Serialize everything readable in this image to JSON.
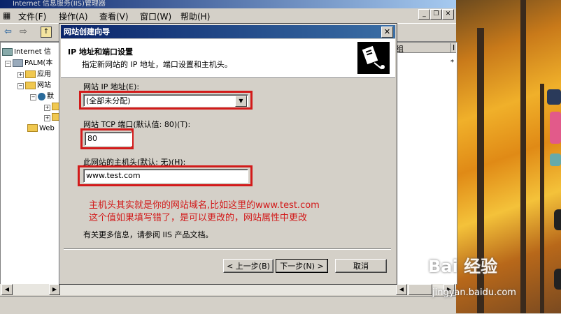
{
  "mmc": {
    "title": "Internet 信息服务(IIS)管理器",
    "menu": [
      "文件(F)",
      "操作(A)",
      "查看(V)",
      "窗口(W)",
      "帮助(H)"
    ],
    "tree": {
      "root": "Internet 信",
      "server": "PALM(本",
      "app_pools": "应用",
      "websites": "网站",
      "default_site": "默",
      "web_ext": "Web"
    },
    "right_col_header": "组",
    "right_col_header2": "I",
    "right_pane_mark": "*"
  },
  "dialog": {
    "title": "网站创建向导",
    "close_label": "✕",
    "header_title": "IP 地址和端口设置",
    "header_subtitle": "指定新网站的 IP 地址，端口设置和主机头。",
    "ip_label": "网站 IP 地址(E):",
    "ip_value": "(全部未分配)",
    "port_label": "网站 TCP 端口(默认值: 80)(T):",
    "port_value": "80",
    "host_label": "此网站的主机头(默认: 无)(H):",
    "host_value": "www.test.com",
    "note_line1": "主机头其实就是你的网站域名,比如这里的www.test.com",
    "note_line2": "这个值如果填写错了，是可以更改的，网站属性中更改",
    "more_info": "有关更多信息，请参阅 IIS 产品文档。",
    "back_button": "< 上一步(B)",
    "next_button": "下一步(N) >",
    "cancel_button": "取消"
  },
  "watermark": {
    "brand": "Bai 经验",
    "url": "jingyan.baidu.com"
  },
  "colors": {
    "annotation_red": "#d21a1a",
    "titlebar_blue": "#0a246a",
    "window_gray": "#d4d0c8"
  }
}
